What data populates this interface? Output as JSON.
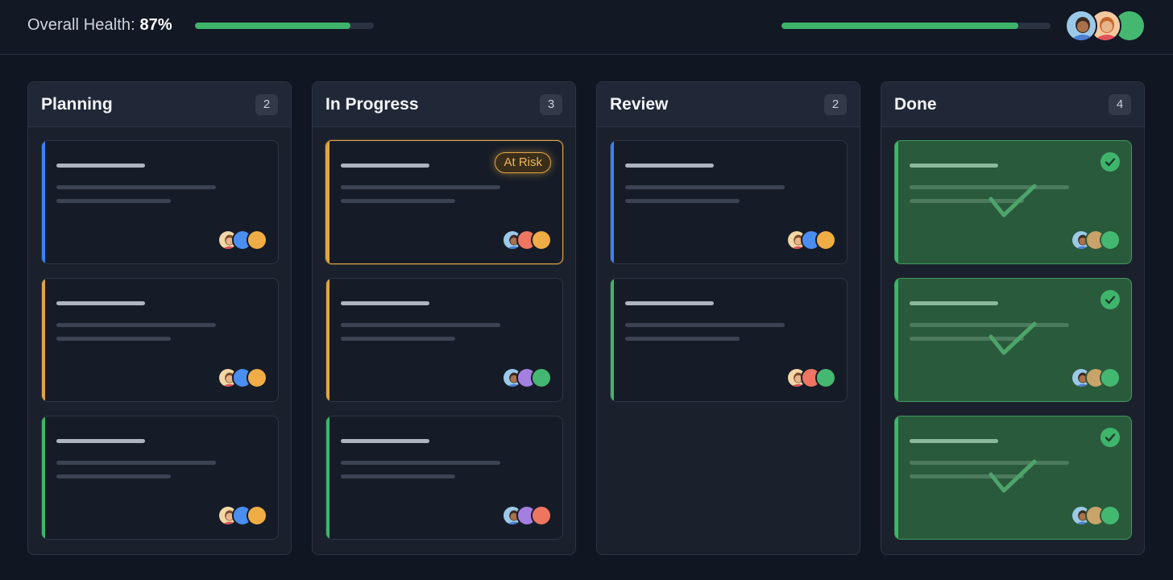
{
  "header": {
    "health_label": "Overall Health:",
    "health_value": "87%",
    "health_progress": 0.87,
    "secondary_progress": 0.88,
    "team_avatars": [
      "person-dark-hair",
      "person-red-hair",
      "green"
    ]
  },
  "colors": {
    "accent_green": "#3fb56c",
    "accent_blue": "#3b82f6",
    "accent_amber": "#e0a446"
  },
  "columns": [
    {
      "title": "Planning",
      "count": "2",
      "cards": [
        {
          "stripe": "blue",
          "avatars": [
            "person-female",
            "blue",
            "orange"
          ]
        },
        {
          "stripe": "amber",
          "avatars": [
            "person-female",
            "blue",
            "orange"
          ]
        },
        {
          "stripe": "green",
          "avatars": [
            "person-female",
            "blue",
            "orange"
          ]
        }
      ]
    },
    {
      "title": "In Progress",
      "count": "3",
      "cards": [
        {
          "stripe": "amber",
          "badge": "At Risk",
          "avatars": [
            "person-male",
            "coral",
            "orange"
          ]
        },
        {
          "stripe": "amber",
          "avatars": [
            "person-male",
            "purple",
            "green"
          ]
        },
        {
          "stripe": "green",
          "avatars": [
            "person-male",
            "purple",
            "coral"
          ]
        }
      ]
    },
    {
      "title": "Review",
      "count": "2",
      "cards": [
        {
          "stripe": "blue",
          "avatars": [
            "person-female",
            "blue",
            "orange"
          ]
        },
        {
          "stripe": "green",
          "avatars": [
            "person-female",
            "coral",
            "green"
          ]
        }
      ]
    },
    {
      "title": "Done",
      "count": "4",
      "cards": [
        {
          "stripe": "green",
          "done": true,
          "avatars": [
            "person-male",
            "tan",
            "green"
          ]
        },
        {
          "stripe": "green",
          "done": true,
          "avatars": [
            "person-male",
            "tan",
            "green"
          ]
        },
        {
          "stripe": "green",
          "done": true,
          "avatars": [
            "person-male",
            "tan",
            "green"
          ]
        }
      ]
    }
  ]
}
